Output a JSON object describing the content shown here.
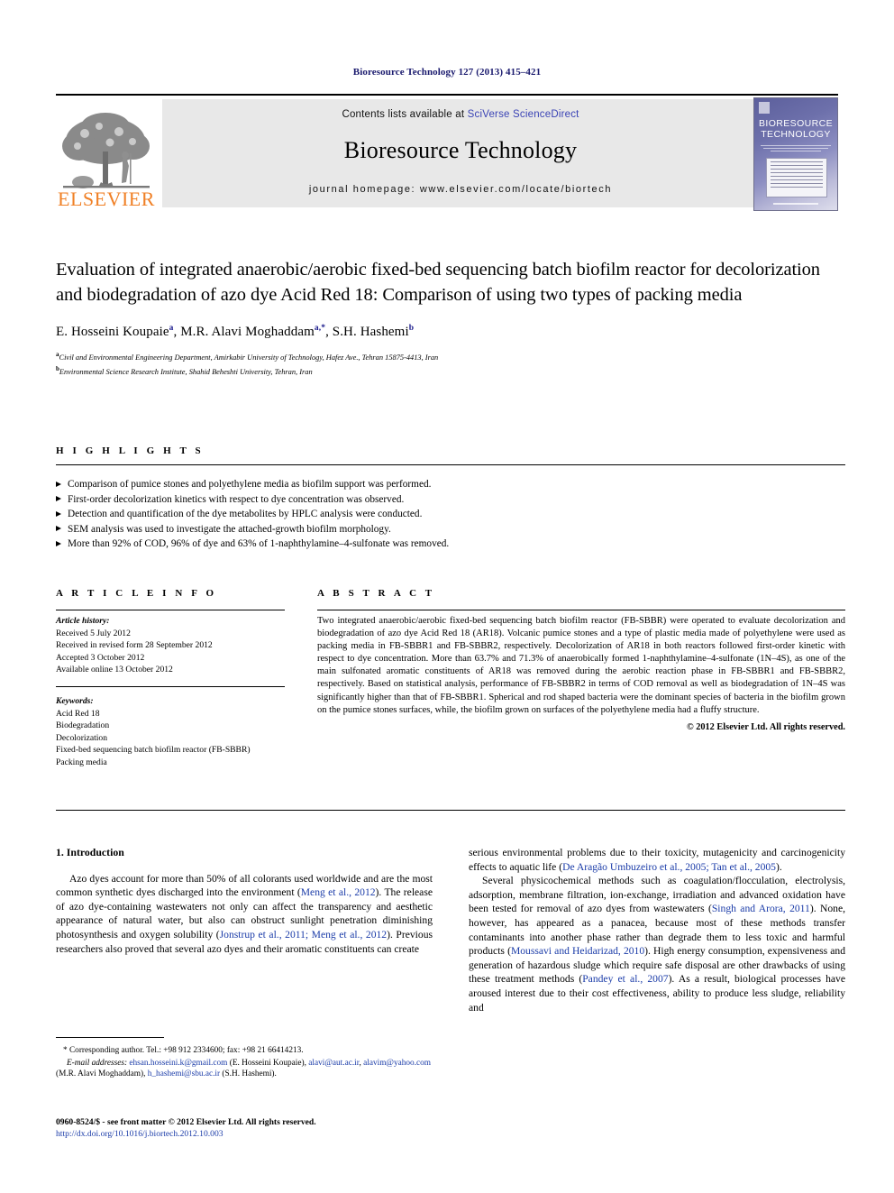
{
  "running_head": "Bioresource Technology 127 (2013) 415–421",
  "masthead": {
    "contents_prefix": "Contents lists available at ",
    "sciencedirect_link": "SciVerse ScienceDirect",
    "journal_title": "Bioresource Technology",
    "homepage": "journal homepage: www.elsevier.com/locate/biortech",
    "publisher_logo_text": "ELSEVIER",
    "cover_title_line1": "BIORESOURCE",
    "cover_title_line2": "TECHNOLOGY"
  },
  "article": {
    "title": "Evaluation of integrated anaerobic/aerobic fixed-bed sequencing batch biofilm reactor for decolorization and biodegradation of azo dye Acid Red 18: Comparison of using two types of packing media",
    "authors": "E. Hosseini Koupaie, M.R. Alavi Moghaddam, S.H. Hashemi",
    "author_list": [
      {
        "name": "E. Hosseini Koupaie",
        "sup": "a"
      },
      {
        "name": "M.R. Alavi Moghaddam",
        "sup": "a,*"
      },
      {
        "name": "S.H. Hashemi",
        "sup": "b"
      }
    ],
    "affiliations": [
      {
        "sup": "a",
        "text": "Civil and Environmental Engineering Department, Amirkabir University of Technology, Hafez Ave., Tehran 15875-4413, Iran"
      },
      {
        "sup": "b",
        "text": "Environmental Science Research Institute, Shahid Beheshti University, Tehran, Iran"
      }
    ]
  },
  "highlights": {
    "heading": "H I G H L I G H T S",
    "items": [
      "Comparison of pumice stones and polyethylene media as biofilm support was performed.",
      "First-order decolorization kinetics with respect to dye concentration was observed.",
      "Detection and quantification of the dye metabolites by HPLC analysis were conducted.",
      "SEM analysis was used to investigate the attached-growth biofilm morphology.",
      "More than 92% of COD, 96% of dye and 63% of 1-naphthylamine–4-sulfonate was removed."
    ]
  },
  "article_info": {
    "heading": "A R T I C L E    I N F O",
    "history_label": "Article history:",
    "history": [
      "Received 5 July 2012",
      "Received in revised form 28 September 2012",
      "Accepted 3 October 2012",
      "Available online 13 October 2012"
    ],
    "keywords_label": "Keywords:",
    "keywords": [
      "Acid Red 18",
      "Biodegradation",
      "Decolorization",
      "Fixed-bed sequencing batch biofilm reactor (FB-SBBR)",
      "Packing media"
    ]
  },
  "abstract": {
    "heading": "A B S T R A C T",
    "text": "Two integrated anaerobic/aerobic fixed-bed sequencing batch biofilm reactor (FB-SBBR) were operated to evaluate decolorization and biodegradation of azo dye Acid Red 18 (AR18). Volcanic pumice stones and a type of plastic media made of polyethylene were used as packing media in FB-SBBR1 and FB-SBBR2, respectively. Decolorization of AR18 in both reactors followed first-order kinetic with respect to dye concentration. More than 63.7% and 71.3% of anaerobically formed 1-naphthylamine–4-sulfonate (1N–4S), as one of the main sulfonated aromatic constituents of AR18 was removed during the aerobic reaction phase in FB-SBBR1 and FB-SBBR2, respectively. Based on statistical analysis, performance of FB-SBBR2 in terms of COD removal as well as biodegradation of 1N–4S was significantly higher than that of FB-SBBR1. Spherical and rod shaped bacteria were the dominant species of bacteria in the biofilm grown on the pumice stones surfaces, while, the biofilm grown on surfaces of the polyethylene media had a fluffy structure.",
    "copyright": "© 2012 Elsevier Ltd. All rights reserved."
  },
  "introduction": {
    "heading": "1. Introduction",
    "left_paragraph_part1": "Azo dyes account for more than 50% of all colorants used worldwide and are the most common synthetic dyes discharged into the environment (",
    "cite_meng": "Meng et al., 2012",
    "left_paragraph_part2": "). The release of azo dye-containing wastewaters not only can affect the transparency and aesthetic appearance of natural water, but also can obstruct sunlight penetration diminishing photosynthesis and oxygen solubility (",
    "cite_jonstrup": "Jonstrup et al., 2011; Meng et al., 2012",
    "left_paragraph_part3": "). Previous researchers also proved that several azo dyes and their aromatic constituents can create",
    "right_part1": "serious environmental problems due to their toxicity, mutagenicity and carcinogenicity effects to aquatic life (",
    "cite_aragao": "De Aragão Umbuzeiro et al., 2005; Tan et al., 2005",
    "right_part2": ").",
    "right_para2_part1": "Several physicochemical methods such as coagulation/flocculation, electrolysis, adsorption, membrane filtration, ion-exchange, irradiation and advanced oxidation have been tested for removal of azo dyes from wastewaters (",
    "cite_singh": "Singh and Arora, 2011",
    "right_para2_part2": "). None, however, has appeared as a panacea, because most of these methods transfer contaminants into another phase rather than degrade them to less toxic and harmful products (",
    "cite_moussavi": "Moussavi and Heidarizad, 2010",
    "right_para2_part3": "). High energy consumption, expensiveness and generation of hazardous sludge which require safe disposal are other drawbacks of using these treatment methods (",
    "cite_pandey": "Pandey et al., 2007",
    "right_para2_part4": "). As a result, biological processes have aroused interest due to their cost effectiveness, ability to produce less sludge, reliability and"
  },
  "footnote": {
    "corresponding": "* Corresponding author. Tel.: +98 912 2334600; fax: +98 21 66414213.",
    "email_label": "E-mail addresses:",
    "email_1": "ehsan.hosseini.k@gmail.com",
    "email_1_owner": " (E. Hosseini Koupaie), ",
    "email_2": "alavi@aut.ac.ir",
    "email_2_sep": ", ",
    "email_3": "alavim@yahoo.com",
    "email_3_owner": " (M.R. Alavi Moghaddam), ",
    "email_4": "h_hashemi@sbu.ac.ir",
    "email_4_owner": " (S.H. Hashemi)."
  },
  "imprint": {
    "issn_line": "0960-8524/$ - see front matter © 2012 Elsevier Ltd. All rights reserved.",
    "doi": "http://dx.doi.org/10.1016/j.biortech.2012.10.003"
  },
  "colors": {
    "running_head": "#1a1a6e",
    "link": "#1a3ba8",
    "sciencedirect": "#3a43b5",
    "elsevier_orange": "#f08026",
    "masthead_bg": "#e8e8e8"
  }
}
